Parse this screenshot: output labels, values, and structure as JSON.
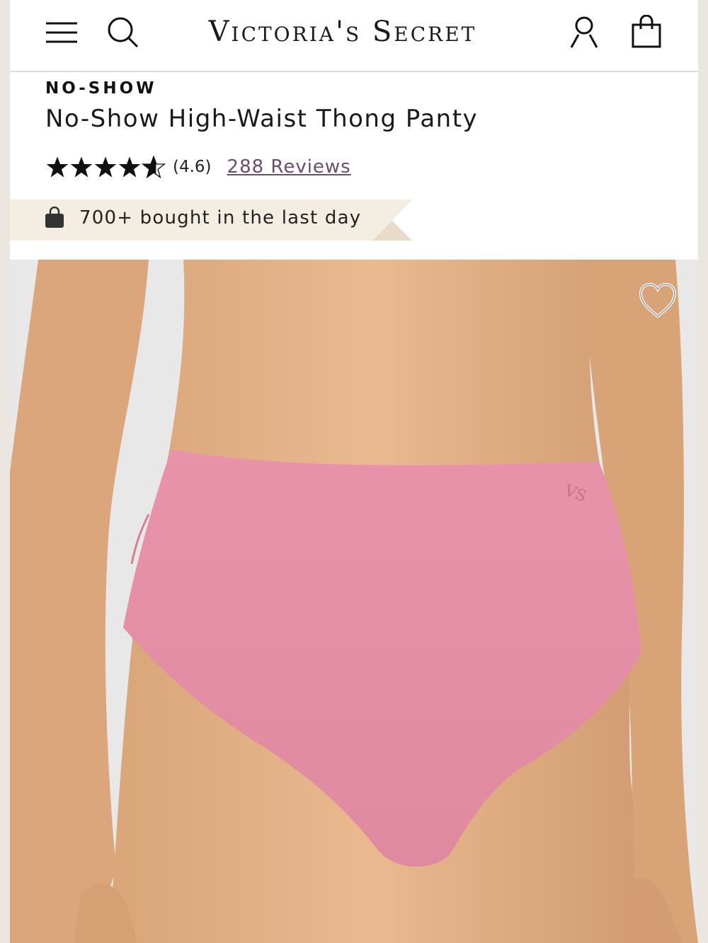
{
  "header": {
    "brand": "Victoria's Secret",
    "icons": [
      "menu-icon",
      "search-icon",
      "account-icon",
      "shopping-bag-icon"
    ]
  },
  "product": {
    "category": "NO-SHOW",
    "title": "No-Show High-Waist Thong Panty",
    "rating": 4.6,
    "rating_text": "(4.6)",
    "reviews_label": "288 Reviews",
    "social_proof": "700+ bought in the last day",
    "color": "#e58fa3"
  },
  "colors": {
    "review_link": "#6b4c6e",
    "banner_bg": "#f4ede2",
    "skin": "#e8b990"
  }
}
